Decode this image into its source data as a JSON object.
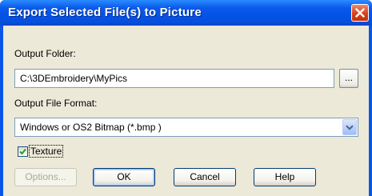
{
  "window": {
    "title": "Export Selected File(s) to Picture",
    "accent_color": "#0452e6",
    "close_icon": "close-icon"
  },
  "output_folder": {
    "label": "Output Folder:",
    "value": "C:\\3DEmbroidery\\MyPics",
    "browse_label": "..."
  },
  "output_format": {
    "label": "Output File Format:",
    "selected": "Windows or OS2 Bitmap (*.bmp )",
    "dropdown_icon": "chevron-down-icon"
  },
  "texture": {
    "label": "Texture",
    "checked": true
  },
  "buttons": {
    "options": "Options...",
    "ok": "OK",
    "cancel": "Cancel",
    "help": "Help"
  }
}
